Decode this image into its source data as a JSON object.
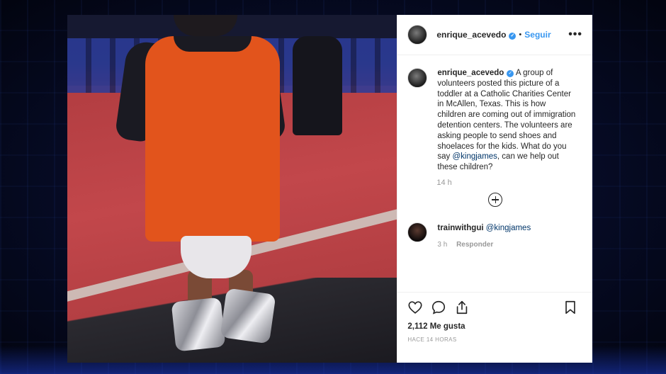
{
  "post": {
    "username": "enrique_acevedo",
    "verified_mark": "✓",
    "separator": "•",
    "follow_label": "Seguir",
    "more_icon": "•••",
    "caption": {
      "username": "enrique_acevedo",
      "text_before": " A group of volunteers posted this picture of a toddler at a Catholic Charities Center in McAllen, Texas. This is how children are coming out of immigration detention centers. The volunteers are asking people to send shoes and shoelaces for the kids. What do you say ",
      "mention": "@kingjames",
      "text_after": ", can we help out these children?",
      "time": "14 h"
    },
    "comments": [
      {
        "username": "trainwithgui",
        "mention": "@kingjames",
        "time": "3 h",
        "reply_label": "Responder"
      }
    ],
    "likes": "2,112 Me gusta",
    "date": "HACE 14 HORAS",
    "icons": [
      "heart-icon",
      "comment-icon",
      "share-icon",
      "bookmark-icon",
      "plus-circle-icon"
    ],
    "colors": {
      "accent": "#3897f0",
      "shirt": "#e2541c",
      "floor": "#b23d41"
    }
  }
}
